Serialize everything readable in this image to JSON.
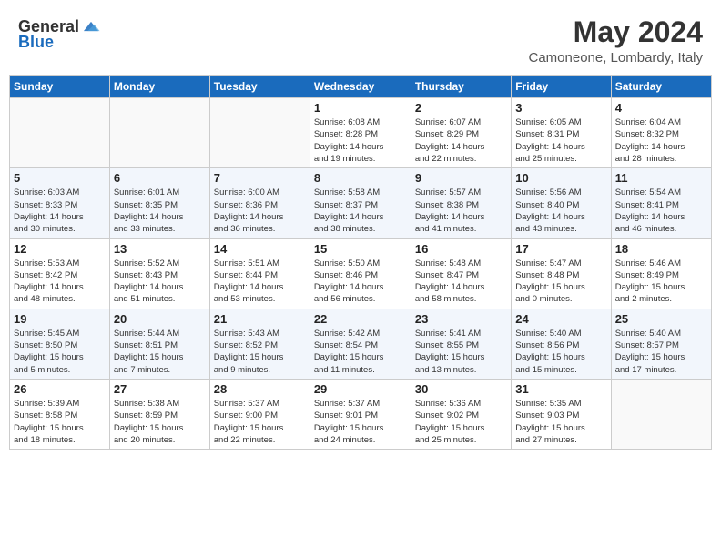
{
  "header": {
    "logo_general": "General",
    "logo_blue": "Blue",
    "month_year": "May 2024",
    "location": "Camoneone, Lombardy, Italy"
  },
  "weekdays": [
    "Sunday",
    "Monday",
    "Tuesday",
    "Wednesday",
    "Thursday",
    "Friday",
    "Saturday"
  ],
  "weeks": [
    [
      {
        "day": "",
        "info": ""
      },
      {
        "day": "",
        "info": ""
      },
      {
        "day": "",
        "info": ""
      },
      {
        "day": "1",
        "info": "Sunrise: 6:08 AM\nSunset: 8:28 PM\nDaylight: 14 hours\nand 19 minutes."
      },
      {
        "day": "2",
        "info": "Sunrise: 6:07 AM\nSunset: 8:29 PM\nDaylight: 14 hours\nand 22 minutes."
      },
      {
        "day": "3",
        "info": "Sunrise: 6:05 AM\nSunset: 8:31 PM\nDaylight: 14 hours\nand 25 minutes."
      },
      {
        "day": "4",
        "info": "Sunrise: 6:04 AM\nSunset: 8:32 PM\nDaylight: 14 hours\nand 28 minutes."
      }
    ],
    [
      {
        "day": "5",
        "info": "Sunrise: 6:03 AM\nSunset: 8:33 PM\nDaylight: 14 hours\nand 30 minutes."
      },
      {
        "day": "6",
        "info": "Sunrise: 6:01 AM\nSunset: 8:35 PM\nDaylight: 14 hours\nand 33 minutes."
      },
      {
        "day": "7",
        "info": "Sunrise: 6:00 AM\nSunset: 8:36 PM\nDaylight: 14 hours\nand 36 minutes."
      },
      {
        "day": "8",
        "info": "Sunrise: 5:58 AM\nSunset: 8:37 PM\nDaylight: 14 hours\nand 38 minutes."
      },
      {
        "day": "9",
        "info": "Sunrise: 5:57 AM\nSunset: 8:38 PM\nDaylight: 14 hours\nand 41 minutes."
      },
      {
        "day": "10",
        "info": "Sunrise: 5:56 AM\nSunset: 8:40 PM\nDaylight: 14 hours\nand 43 minutes."
      },
      {
        "day": "11",
        "info": "Sunrise: 5:54 AM\nSunset: 8:41 PM\nDaylight: 14 hours\nand 46 minutes."
      }
    ],
    [
      {
        "day": "12",
        "info": "Sunrise: 5:53 AM\nSunset: 8:42 PM\nDaylight: 14 hours\nand 48 minutes."
      },
      {
        "day": "13",
        "info": "Sunrise: 5:52 AM\nSunset: 8:43 PM\nDaylight: 14 hours\nand 51 minutes."
      },
      {
        "day": "14",
        "info": "Sunrise: 5:51 AM\nSunset: 8:44 PM\nDaylight: 14 hours\nand 53 minutes."
      },
      {
        "day": "15",
        "info": "Sunrise: 5:50 AM\nSunset: 8:46 PM\nDaylight: 14 hours\nand 56 minutes."
      },
      {
        "day": "16",
        "info": "Sunrise: 5:48 AM\nSunset: 8:47 PM\nDaylight: 14 hours\nand 58 minutes."
      },
      {
        "day": "17",
        "info": "Sunrise: 5:47 AM\nSunset: 8:48 PM\nDaylight: 15 hours\nand 0 minutes."
      },
      {
        "day": "18",
        "info": "Sunrise: 5:46 AM\nSunset: 8:49 PM\nDaylight: 15 hours\nand 2 minutes."
      }
    ],
    [
      {
        "day": "19",
        "info": "Sunrise: 5:45 AM\nSunset: 8:50 PM\nDaylight: 15 hours\nand 5 minutes."
      },
      {
        "day": "20",
        "info": "Sunrise: 5:44 AM\nSunset: 8:51 PM\nDaylight: 15 hours\nand 7 minutes."
      },
      {
        "day": "21",
        "info": "Sunrise: 5:43 AM\nSunset: 8:52 PM\nDaylight: 15 hours\nand 9 minutes."
      },
      {
        "day": "22",
        "info": "Sunrise: 5:42 AM\nSunset: 8:54 PM\nDaylight: 15 hours\nand 11 minutes."
      },
      {
        "day": "23",
        "info": "Sunrise: 5:41 AM\nSunset: 8:55 PM\nDaylight: 15 hours\nand 13 minutes."
      },
      {
        "day": "24",
        "info": "Sunrise: 5:40 AM\nSunset: 8:56 PM\nDaylight: 15 hours\nand 15 minutes."
      },
      {
        "day": "25",
        "info": "Sunrise: 5:40 AM\nSunset: 8:57 PM\nDaylight: 15 hours\nand 17 minutes."
      }
    ],
    [
      {
        "day": "26",
        "info": "Sunrise: 5:39 AM\nSunset: 8:58 PM\nDaylight: 15 hours\nand 18 minutes."
      },
      {
        "day": "27",
        "info": "Sunrise: 5:38 AM\nSunset: 8:59 PM\nDaylight: 15 hours\nand 20 minutes."
      },
      {
        "day": "28",
        "info": "Sunrise: 5:37 AM\nSunset: 9:00 PM\nDaylight: 15 hours\nand 22 minutes."
      },
      {
        "day": "29",
        "info": "Sunrise: 5:37 AM\nSunset: 9:01 PM\nDaylight: 15 hours\nand 24 minutes."
      },
      {
        "day": "30",
        "info": "Sunrise: 5:36 AM\nSunset: 9:02 PM\nDaylight: 15 hours\nand 25 minutes."
      },
      {
        "day": "31",
        "info": "Sunrise: 5:35 AM\nSunset: 9:03 PM\nDaylight: 15 hours\nand 27 minutes."
      },
      {
        "day": "",
        "info": ""
      }
    ]
  ]
}
